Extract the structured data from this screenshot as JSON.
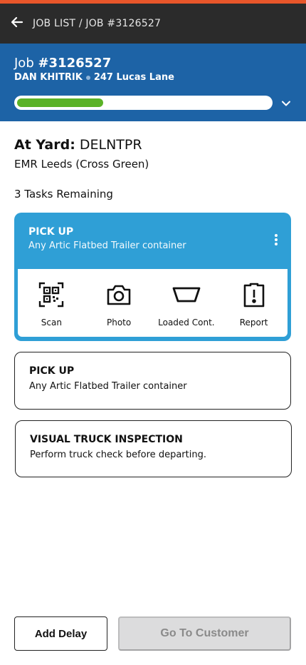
{
  "colors": {
    "accent": "#e8562a",
    "topbar": "#2b2b2b",
    "header_blue": "#1d63a6",
    "progress_green": "#5ab227",
    "card_active_blue": "#2f9fd6",
    "disabled_button": "#dcdcdd"
  },
  "topbar": {
    "back_icon": "arrow-left-icon",
    "breadcrumb": "JOB LIST / JOB #3126527"
  },
  "job": {
    "title_prefix": "Job ",
    "number": "#3126527",
    "driver": "DAN KHITRIK",
    "address": "247 Lucas Lane",
    "progress_fraction": 0.34,
    "expand_icon": "chevron-down-icon"
  },
  "yard": {
    "label": "At Yard:",
    "code": "DELNTPR",
    "name": "EMR Leeds (Cross Green)"
  },
  "tasks_remaining": "3 Tasks Remaining",
  "tasks": [
    {
      "title": "PICK UP",
      "subtitle": "Any Artic Flatbed Trailer container",
      "menu_icon": "more-vertical-icon",
      "actions": [
        {
          "label": "Scan",
          "icon": "qr-scan-icon"
        },
        {
          "label": "Photo",
          "icon": "camera-icon"
        },
        {
          "label": "Loaded Cont.",
          "icon": "container-icon"
        },
        {
          "label": "Report",
          "icon": "report-alert-icon"
        }
      ]
    },
    {
      "title": "PICK UP",
      "subtitle": "Any Artic Flatbed Trailer container"
    },
    {
      "title": "VISUAL TRUCK INSPECTION",
      "subtitle": "Perform truck check before departing."
    }
  ],
  "footer": {
    "delay_label": "Add Delay",
    "go_label": "Go To Customer"
  }
}
